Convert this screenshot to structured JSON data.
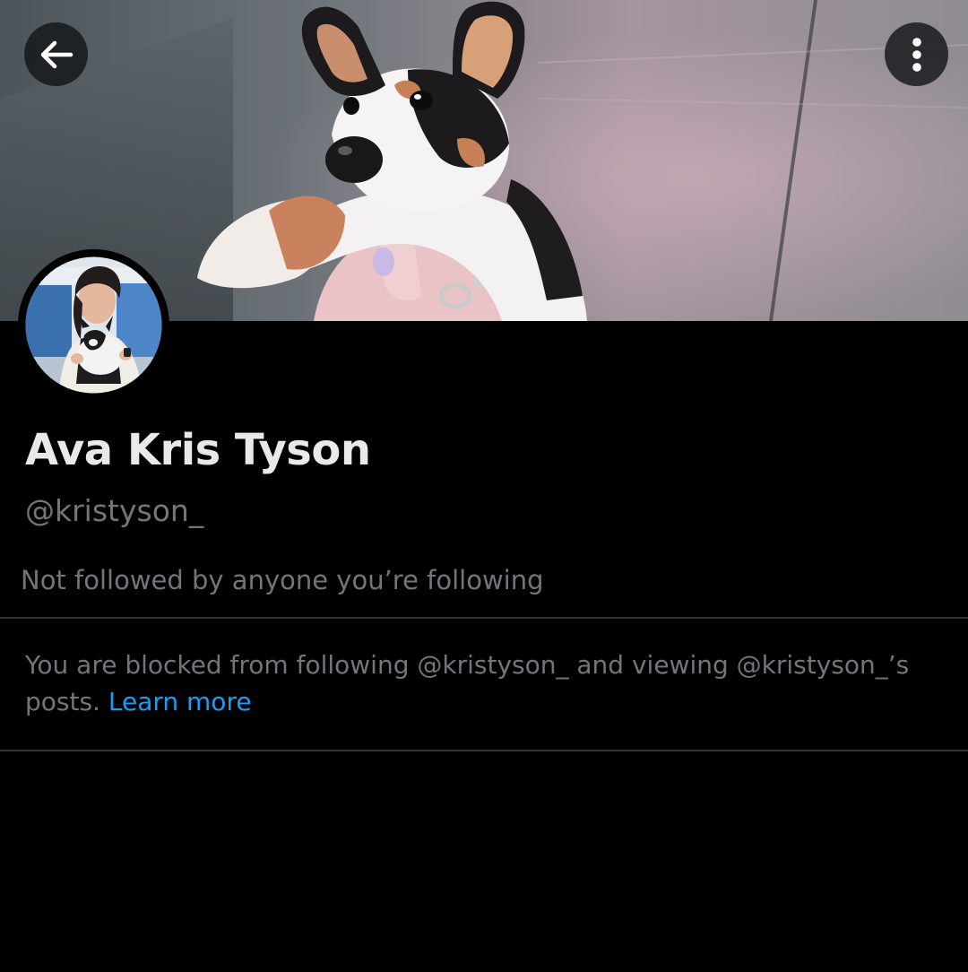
{
  "header": {
    "back_icon": "arrow-left-icon",
    "more_icon": "more-vertical-icon"
  },
  "profile": {
    "display_name": "Ava Kris Tyson",
    "handle": "@kristyson_",
    "followed_by": "Not followed by anyone you’re following"
  },
  "blocked": {
    "text": "You are blocked from following @kristyson_ and viewing @kristyson_’s posts.",
    "learn_more_label": "Learn more"
  },
  "colors": {
    "background": "#000000",
    "primary_text": "#e7e9ea",
    "secondary_text": "#71767b",
    "link": "#1d9bf0",
    "divider": "#2f3336"
  }
}
